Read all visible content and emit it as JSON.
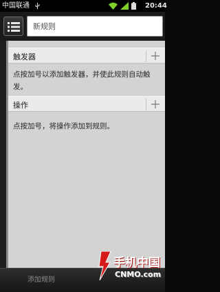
{
  "status_bar": {
    "carrier": "中国联通",
    "time": "20:44",
    "icons": [
      "usb-icon",
      "wifi-icon",
      "signal-icon",
      "battery-icon"
    ]
  },
  "header": {
    "menu_icon": "list-icon",
    "rule_name_placeholder": "新规则",
    "rule_name_value": ""
  },
  "sections": [
    {
      "title": "触发器",
      "add_icon": "plus-icon",
      "description": "点按加号以添加触发器，并使此规则自动触发。"
    },
    {
      "title": "操作",
      "add_icon": "plus-icon",
      "description": "点按加号，将操作添加到规则。"
    }
  ],
  "bottom_bar": {
    "add_rule_label": "添加规则"
  },
  "watermark": {
    "brand_cn": "手机中国",
    "brand_en": "CNMO.com"
  },
  "colors": {
    "content_bg": "#d3d3d3",
    "section_header_bg": "#ebebeb",
    "status_bar_bg": "#000000",
    "watermark_red": "#d41a1a"
  }
}
